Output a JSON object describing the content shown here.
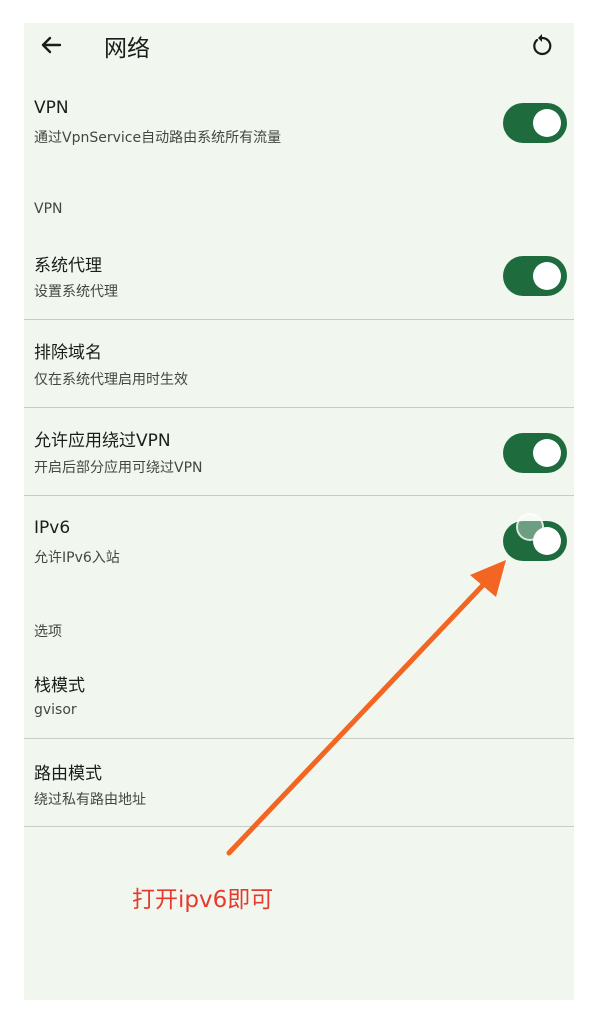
{
  "appbar": {
    "back_icon": "arrow-left-icon",
    "title": "网络",
    "refresh_icon": "refresh-icon"
  },
  "settings": {
    "vpn": {
      "title": "VPN",
      "subtitle": "通过VpnService自动路由系统所有流量",
      "enabled": true
    },
    "vpn_section": "VPN",
    "system_proxy": {
      "title": "系统代理",
      "subtitle": "设置系统代理",
      "enabled": true
    },
    "exclude_domains": {
      "title": "排除域名",
      "subtitle": "仅在系统代理启用时生效"
    },
    "bypass_vpn": {
      "title": "允许应用绕过VPN",
      "subtitle": "开启后部分应用可绕过VPN",
      "enabled": true
    },
    "ipv6": {
      "title": "IPv6",
      "subtitle": "允许IPv6入站",
      "enabled": true
    },
    "options_section": "选项",
    "stack_mode": {
      "title": "栈模式",
      "subtitle": "gvisor"
    },
    "route_mode": {
      "title": "路由模式",
      "subtitle": "绕过私有路由地址"
    }
  },
  "annotation": {
    "text": "打开ipv6即可",
    "color": "#e53b2f",
    "arrow_color": "#f26522"
  },
  "colors": {
    "toggle_on": "#1e6b3e",
    "background": "#f1f7ef"
  }
}
